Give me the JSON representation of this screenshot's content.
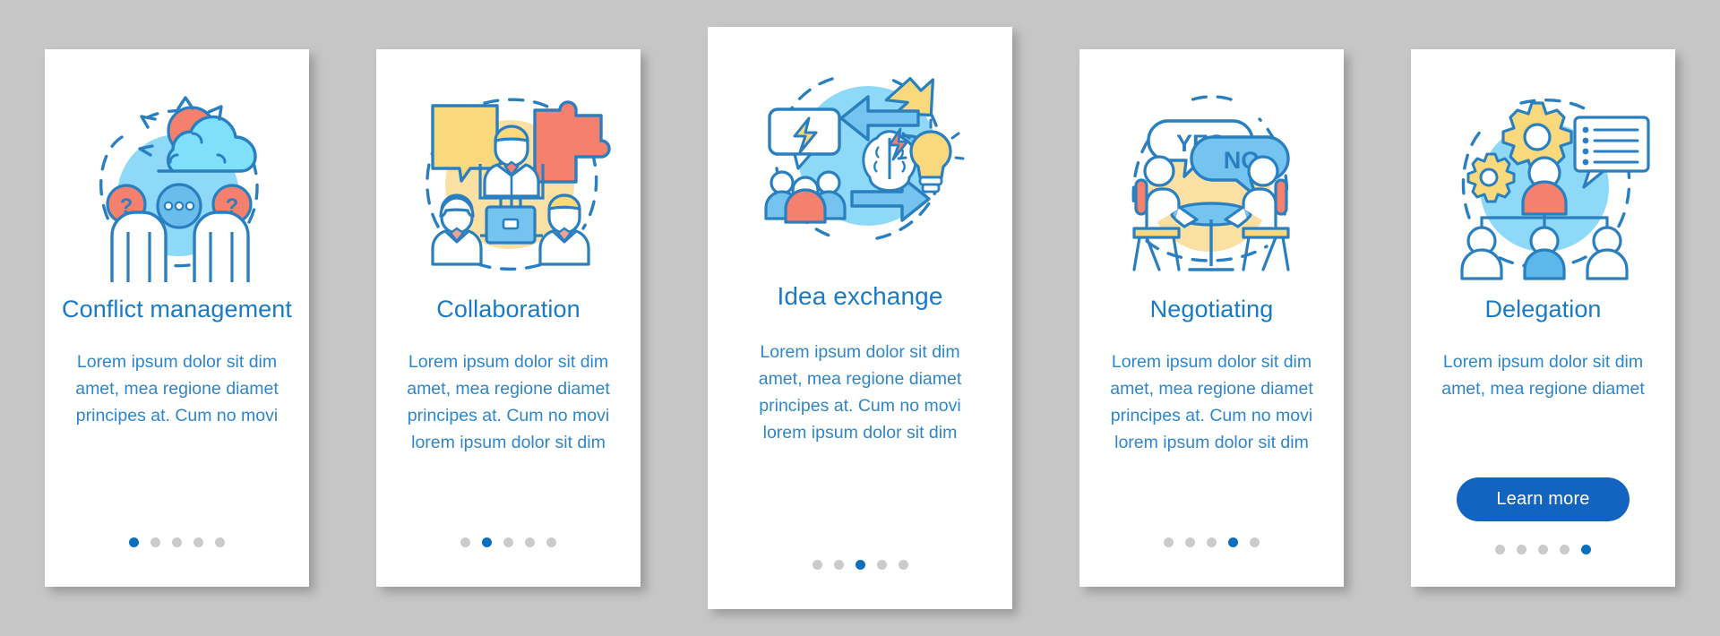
{
  "theme": {
    "page_background": "#c6c6c6",
    "card_background": "#ffffff",
    "title_color": "#1a7bc4",
    "body_color": "#2f86c8",
    "accent_blue": "#0d6ebd",
    "button_blue": "#1264c0",
    "dot_inactive": "#c9cbcd",
    "illustration_blue": "#2a7fc0",
    "illustration_light_blue": "#8ed8f8",
    "illustration_mid_blue": "#68bdec",
    "illustration_yellow": "#f7d97b",
    "illustration_coral": "#f5806d"
  },
  "cards": [
    {
      "id": "conflict-management",
      "illustration": "conflict-management-illustration",
      "title": "Conflict management",
      "body": "Lorem ipsum dolor sit dim amet, mea regione diamet principes at. Cum no movi",
      "dots": {
        "count": 5,
        "active_index": 0
      },
      "has_button": false,
      "button_label": ""
    },
    {
      "id": "collaboration",
      "illustration": "collaboration-illustration",
      "title": "Collaboration",
      "body": "Lorem ipsum dolor sit dim amet, mea regione diamet principes at. Cum no movi lorem ipsum dolor sit dim",
      "dots": {
        "count": 5,
        "active_index": 1
      },
      "has_button": false,
      "button_label": ""
    },
    {
      "id": "idea-exchange",
      "illustration": "idea-exchange-illustration",
      "title": "Idea exchange",
      "body": "Lorem ipsum dolor sit dim amet, mea regione diamet principes at. Cum no movi lorem ipsum dolor sit dim",
      "dots": {
        "count": 5,
        "active_index": 2
      },
      "has_button": false,
      "button_label": ""
    },
    {
      "id": "negotiating",
      "illustration": "negotiating-illustration",
      "title": "Negotiating",
      "body": "Lorem ipsum dolor sit dim amet, mea regione diamet principes at. Cum no movi lorem ipsum dolor sit dim",
      "dots": {
        "count": 5,
        "active_index": 3
      },
      "has_button": false,
      "button_label": ""
    },
    {
      "id": "delegation",
      "illustration": "delegation-illustration",
      "title": "Delegation",
      "body": "Lorem ipsum dolor sit dim amet, mea regione diamet",
      "dots": {
        "count": 5,
        "active_index": 4
      },
      "has_button": true,
      "button_label": "Learn more"
    }
  ],
  "illustration_labels": {
    "negotiating_yes": "YES",
    "negotiating_no": "NO"
  }
}
